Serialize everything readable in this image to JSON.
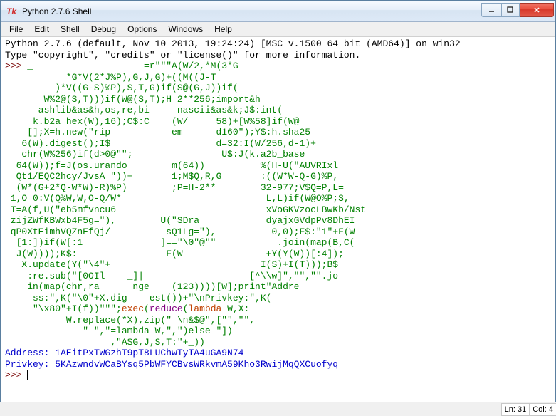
{
  "window": {
    "title": "Python 2.7.6 Shell"
  },
  "menu": {
    "items": [
      "File",
      "Edit",
      "Shell",
      "Debug",
      "Options",
      "Windows",
      "Help"
    ]
  },
  "shell": {
    "banner1": "Python 2.7.6 (default, Nov 10 2013, 19:24:24) [MSC v.1500 64 bit (AMD64)] on win32",
    "banner2": "Type \"copyright\", \"credits\" or \"license()\" for more information.",
    "prompt": ">>> ",
    "code_lines": [
      "_                    =r\"\"\"A(W/2,*M(3*G",
      "           *G*V(2*J%P),G,J,G)+((M((J-T",
      "         )*V((G-S)%P),S,T,G)if(S@(G,J))if(",
      "       W%2@(S,T)))if(W@(S,T);H=2**256;import&h",
      "      ashlib&as&h,os,re,bi     nascii&as&k;J$:int(",
      "     k.b2a_hex(W),16);C$:C    (W/     58)+[W%58]if(W@",
      "    [];X=h.new(\"rip           em      d160\");Y$:h.sha25",
      "   6(W).digest();I$                   d=32:I(W/256,d-1)+",
      "   chr(W%256)if(d>0@\"\";                U$:J(k.a2b_base",
      "  64(W));f=J(os.urando        m(64))          %(H-U(\"AUVRIxl",
      "  Qt1/EQC2hcy/JvsA=\"))+       1;M$Q,R,G       :((W*W-Q-G)%P,",
      "  (W*(G+2*Q-W*W)-R)%P)        ;P=H-2**        32-977;V$Q=P,L=",
      " 1,O=0:V(Q%W,W,O-Q/W*                          L,L)if(W@O%P;S,",
      " T=A(f,U(\"eb5mfvncu6                           xVoGKVzocLBwKb/Nst",
      " zijZWfKBWxb4F5g=\"),        U(\"SDra            dyajxGVdpPv8DhEI",
      " qP0XtEimhVQZnEfQj/          sQ1Lg=\"),          0,0);F$:\"1\"+F(W",
      "  [1:])if(W[:1              ]==\"\\0\"@\"\"           .join(map(B,C(",
      "  J(W))));K$:                F(W               +Y(Y(W))[:4]);",
      "   X.update(Y(\"\\4\"+                           I(S)+I(T)));B$",
      "    :re.sub(\"[0OIl    _]|                   [^\\\\w]\",\"\",\"\".jo",
      "    in(map(chr,ra      nge    (123))))[W];print\"Addre",
      "     ss:\",K(\"\\0\"+X.dig    est())+\"\\nPrivkey:\",K(",
      "     \"\\x80\"+I(f))\"\"\";",
      "exec",
      "(",
      "reduce",
      "(",
      "lambda",
      " W,X:",
      "           W.replace(*X),zip(\" \\n&$@\",[\"\",\"\",",
      "              \" \",\"=lambda W,\",\")else \"])",
      "                   ,\"A$G,J,S,T:\"+_))"
    ],
    "output1_label": "Address: ",
    "output1_value": "1AEitPxTWGzhT9pT8LUChwTyTA4uGA9N74",
    "output2_label": "Privkey: ",
    "output2_value": "5KAzwndvWCaBYsq5PbWFYCBvsWRkvmA59Kho3RwijMqQXCuofyq"
  },
  "status": {
    "line": "Ln: 31",
    "col": "Col: 4"
  }
}
